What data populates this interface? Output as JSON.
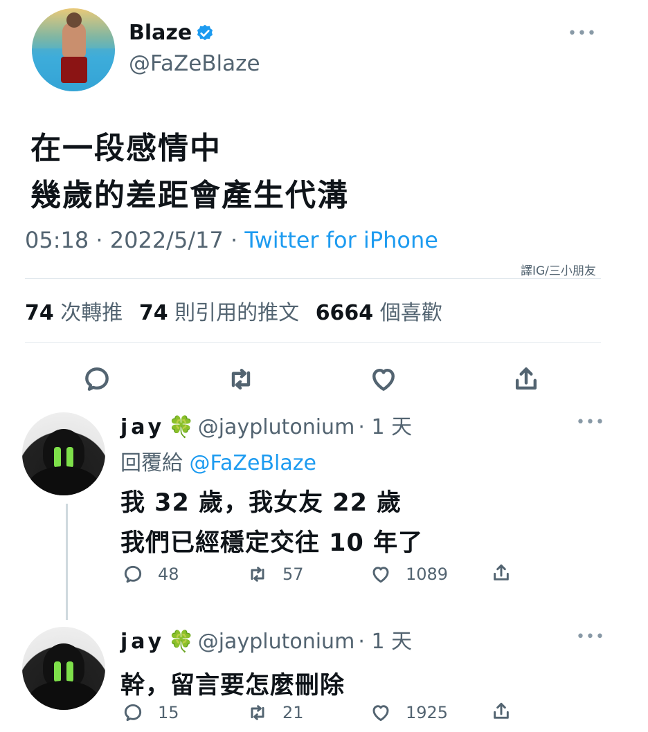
{
  "main_tweet": {
    "name": "Blaze",
    "handle": "@FaZeBlaze",
    "more": "•••",
    "text_lines": [
      "在一段感情中",
      "幾歲的差距會產生代溝"
    ],
    "time": "05:18",
    "date": "2022/5/17",
    "source": "Twitter for iPhone",
    "separator": " · ",
    "credit": "譯IG/三小朋友",
    "stats": {
      "retweets_count": "74",
      "retweets_label": "次轉推",
      "quotes_count": "74",
      "quotes_label": "則引用的推文",
      "likes_count": "6664",
      "likes_label": "個喜歡"
    }
  },
  "replies": [
    {
      "name": "jay",
      "emoji": "🍀",
      "handle": "@jayplutonium",
      "age": "· 1 天",
      "more": "•••",
      "reply_to_label": "回覆給",
      "reply_to_handle": "@FaZeBlaze",
      "text_lines": [
        "我 32 歲，我女友 22 歲",
        "我們已經穩定交往 10 年了"
      ],
      "reply_count": "48",
      "retweet_count": "57",
      "like_count": "1089"
    },
    {
      "name": "jay",
      "emoji": "🍀",
      "handle": "@jayplutonium",
      "age": "· 1 天",
      "more": "•••",
      "text_lines": [
        "幹，留言要怎麼刪除"
      ],
      "reply_count": "15",
      "retweet_count": "21",
      "like_count": "1925"
    }
  ],
  "colors": {
    "link": "#1d9bf0",
    "secondary_text": "#536471",
    "primary_text": "#0f1419",
    "verified": "#1d9bf0",
    "clover": "#2e9d2e"
  },
  "icons": [
    "verified-badge-icon",
    "reply-icon",
    "retweet-icon",
    "like-icon",
    "share-icon",
    "more-icon"
  ]
}
